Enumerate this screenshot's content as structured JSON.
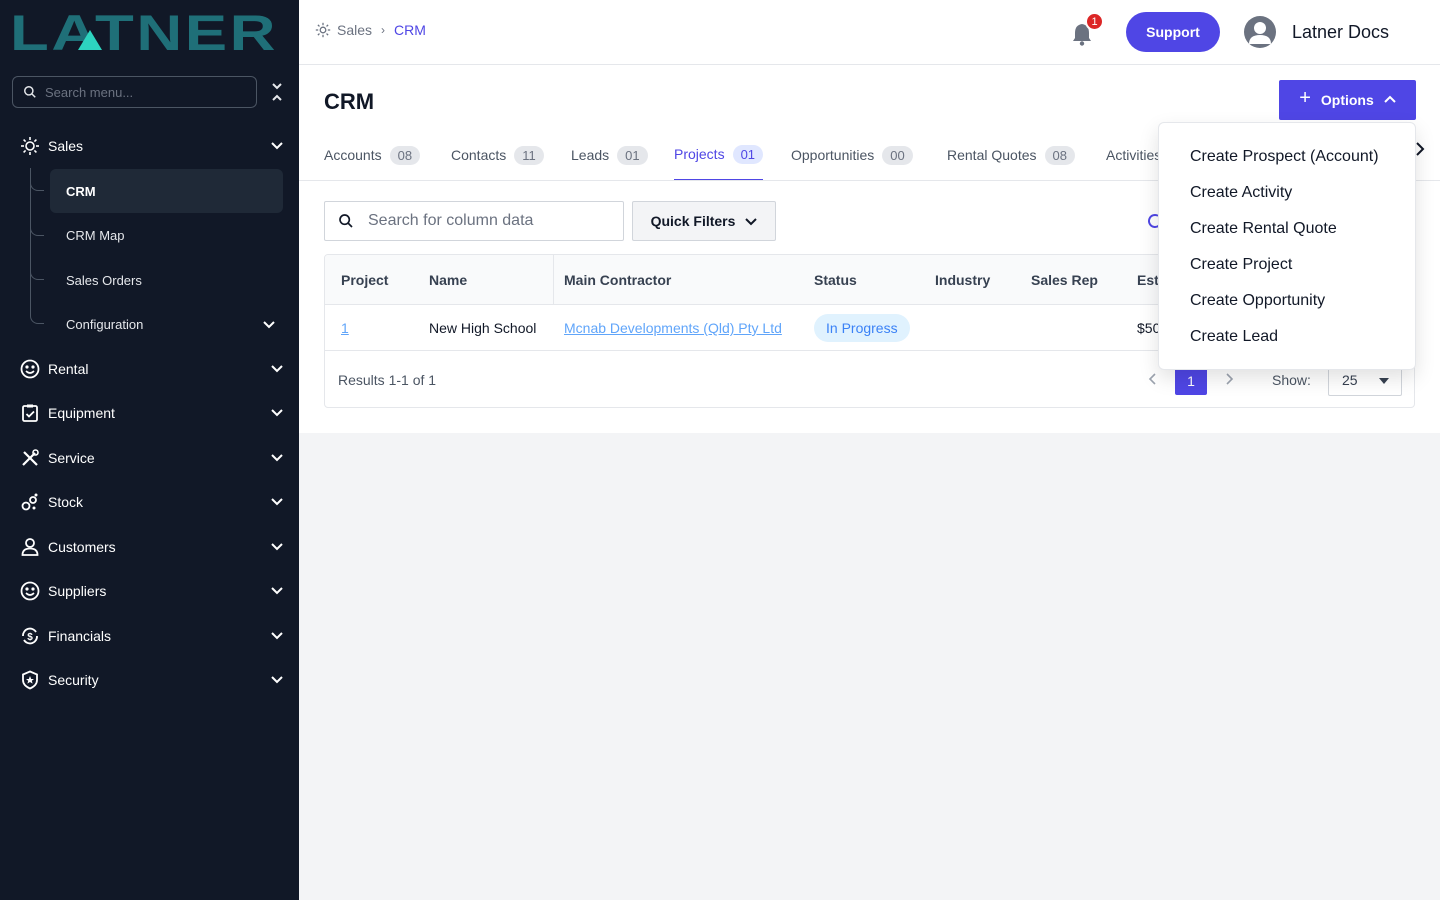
{
  "app": {
    "logo_text": "LATNER",
    "menu_search_placeholder": "Search menu..."
  },
  "sidebar": {
    "items": [
      {
        "label": "Sales",
        "icon": "sales-icon"
      },
      {
        "label": "Rental",
        "icon": "rental-icon"
      },
      {
        "label": "Equipment",
        "icon": "clipboard-check-icon"
      },
      {
        "label": "Service",
        "icon": "tools-icon"
      },
      {
        "label": "Stock",
        "icon": "stock-icon"
      },
      {
        "label": "Customers",
        "icon": "user-icon"
      },
      {
        "label": "Suppliers",
        "icon": "suppliers-icon"
      },
      {
        "label": "Financials",
        "icon": "dollar-cycle-icon"
      },
      {
        "label": "Security",
        "icon": "shield-star-icon"
      }
    ],
    "sales_sub": [
      {
        "label": "CRM",
        "active": true
      },
      {
        "label": "CRM Map"
      },
      {
        "label": "Sales Orders"
      },
      {
        "label": "Configuration"
      }
    ]
  },
  "header": {
    "breadcrumb": [
      "Sales",
      "CRM"
    ],
    "notification_count": "1",
    "support_label": "Support",
    "user_name": "Latner Docs"
  },
  "main": {
    "title": "CRM",
    "options_label": "Options",
    "tabs": [
      {
        "label": "Accounts",
        "count": "08"
      },
      {
        "label": "Contacts",
        "count": "11"
      },
      {
        "label": "Leads",
        "count": "01"
      },
      {
        "label": "Projects",
        "count": "01",
        "active": true
      },
      {
        "label": "Opportunities",
        "count": "00"
      },
      {
        "label": "Rental Quotes",
        "count": "08"
      },
      {
        "label": "Activities",
        "count": ""
      }
    ],
    "search_placeholder": "Search for column data",
    "quick_filters_label": "Quick Filters",
    "table": {
      "columns": [
        "Project",
        "Name",
        "Main Contractor",
        "Status",
        "Industry",
        "Sales Rep",
        "Est"
      ],
      "rows": [
        {
          "project": "1",
          "name": "New High School",
          "main_contractor": "Mcnab Developments (Qld) Pty Ltd",
          "status": "In Progress",
          "industry": "",
          "sales_rep": "",
          "est": "$50"
        }
      ]
    },
    "results_text": "Results 1-1 of 1",
    "current_page": "1",
    "show_label": "Show:",
    "page_size": "25"
  },
  "options_menu": [
    "Create Prospect (Account)",
    "Create Activity",
    "Create Rental Quote",
    "Create Project",
    "Create Opportunity",
    "Create Lead"
  ],
  "colors": {
    "sidebar_bg": "#111827",
    "accent": "#4f46e5",
    "logo_teal": "#1f6f78",
    "badge_red": "#dc2626"
  }
}
